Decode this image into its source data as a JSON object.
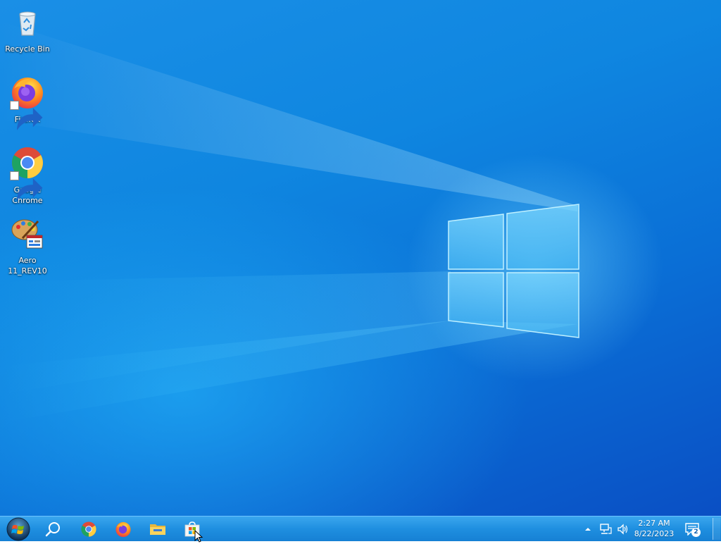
{
  "desktop": {
    "icons": [
      {
        "label": "Recycle Bin",
        "icon": "recycle-bin-icon"
      },
      {
        "label": "Firefox",
        "icon": "firefox-icon"
      },
      {
        "label": "Google Chrome",
        "icon": "chrome-icon"
      },
      {
        "label": "Aero 11_REV10",
        "icon": "aero-paint-icon"
      }
    ]
  },
  "taskbar": {
    "start": "windows-start-icon",
    "pinned": [
      "search-icon",
      "chrome-icon",
      "firefox-icon",
      "file-explorer-icon",
      "microsoft-store-icon"
    ],
    "tray": {
      "chevron": "show-hidden-icons-chevron",
      "network": "network-icon",
      "volume": "volume-icon",
      "time": "2:27 AM",
      "date": "8/22/2023",
      "notifications_count": "2"
    }
  },
  "colors": {
    "taskbar": "#1f8fe0",
    "wallpaper": "#0f86e0"
  }
}
